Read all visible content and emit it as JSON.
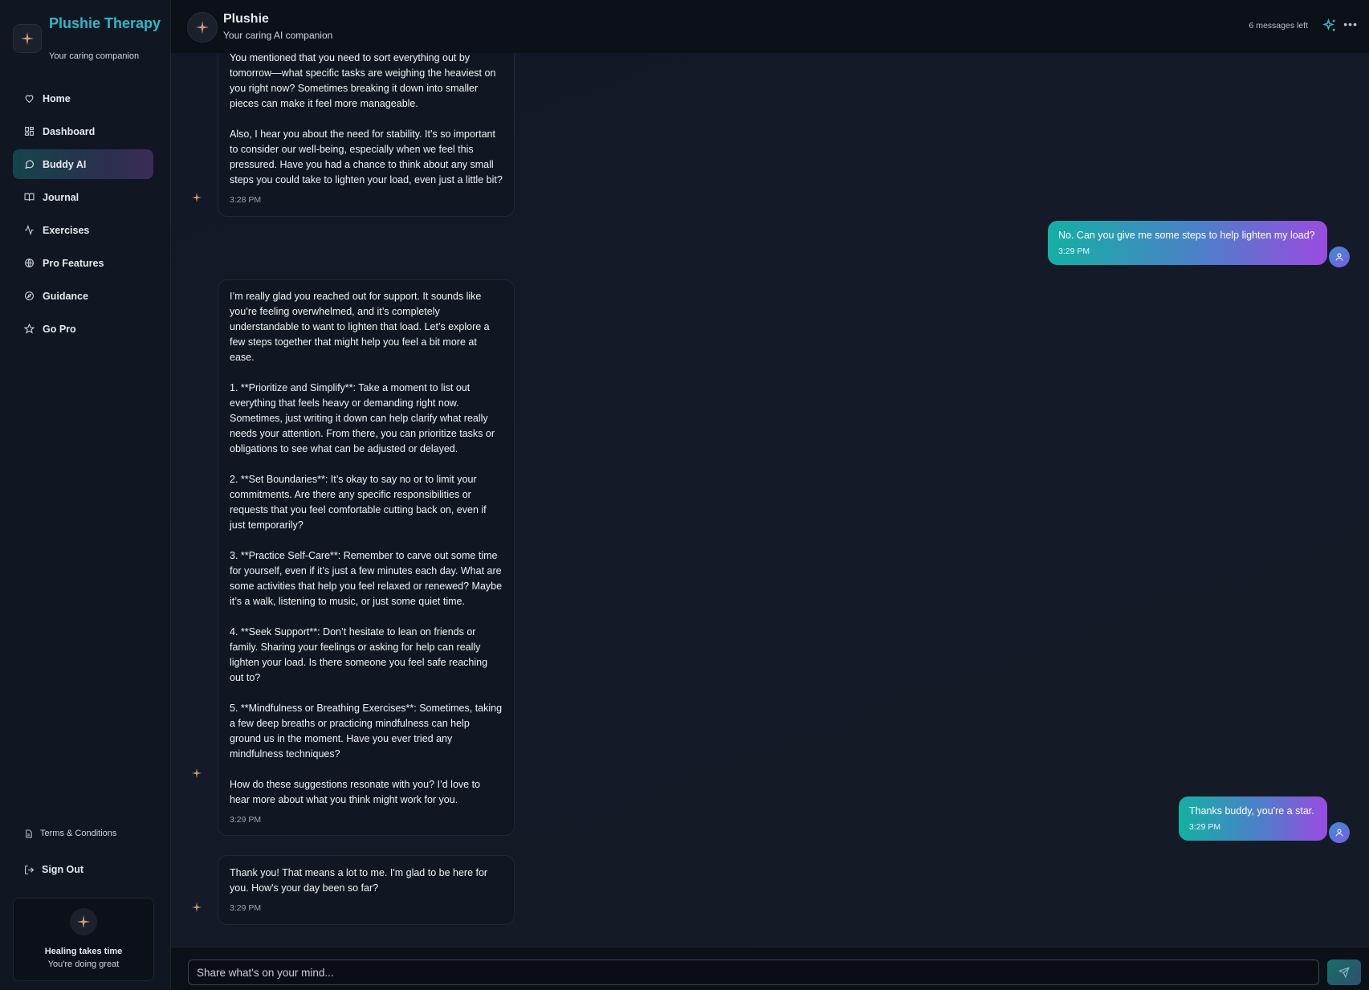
{
  "brand": {
    "title": "Plushie Therapy",
    "subtitle": "Your caring companion"
  },
  "nav": [
    {
      "label": "Home",
      "icon": "heart-icon"
    },
    {
      "label": "Dashboard",
      "icon": "grid-icon"
    },
    {
      "label": "Buddy AI",
      "icon": "chat-icon",
      "active": true
    },
    {
      "label": "Journal",
      "icon": "book-icon"
    },
    {
      "label": "Exercises",
      "icon": "activity-icon"
    },
    {
      "label": "Pro Features",
      "icon": "globe-icon"
    },
    {
      "label": "Guidance",
      "icon": "compass-icon"
    },
    {
      "label": "Go Pro",
      "icon": "star-icon"
    }
  ],
  "footer": {
    "terms": "Terms & Conditions",
    "signout": "Sign Out",
    "card_title": "Healing takes time",
    "card_subtitle": "You're doing great"
  },
  "header": {
    "title": "Plushie",
    "subtitle": "Your caring AI companion",
    "messages_left": "6 messages left"
  },
  "messages": [
    {
      "role": "ai",
      "paragraphs": [
        "You mentioned that you need to sort everything out by tomorrow—what specific tasks are weighing the heaviest on you right now? Sometimes breaking it down into smaller pieces can make it feel more manageable.",
        "Also, I hear you about the need for stability. It’s so important to consider our well-being, especially when we feel this pressured. Have you had a chance to think about any small steps you could take to lighten your load, even just a little bit?"
      ],
      "time": "3:28 PM"
    },
    {
      "role": "user",
      "text": "No. Can you give me some steps to help lighten my load?",
      "time": "3:29 PM"
    },
    {
      "role": "ai",
      "paragraphs": [
        "I’m really glad you reached out for support. It sounds like you’re feeling overwhelmed, and it’s completely understandable to want to lighten that load. Let’s explore a few steps together that might help you feel a bit more at ease.",
        "1. **Prioritize and Simplify**: Take a moment to list out everything that feels heavy or demanding right now. Sometimes, just writing it down can help clarify what really needs your attention. From there, you can prioritize tasks or obligations to see what can be adjusted or delayed.",
        "2. **Set Boundaries**: It’s okay to say no or to limit your commitments. Are there any specific responsibilities or requests that you feel comfortable cutting back on, even if just temporarily?",
        "3. **Practice Self-Care**: Remember to carve out some time for yourself, even if it’s just a few minutes each day. What are some activities that help you feel relaxed or renewed? Maybe it’s a walk, listening to music, or just some quiet time.",
        "4. **Seek Support**: Don’t hesitate to lean on friends or family. Sharing your feelings or asking for help can really lighten your load. Is there someone you feel safe reaching out to?",
        "5. **Mindfulness or Breathing Exercises**: Sometimes, taking a few deep breaths or practicing mindfulness can help ground us in the moment. Have you ever tried any mindfulness techniques?",
        "How do these suggestions resonate with you? I’d love to hear more about what you think might work for you."
      ],
      "time": "3:29 PM"
    },
    {
      "role": "user",
      "text": "Thanks buddy, you're a star.",
      "time": "3:29 PM"
    },
    {
      "role": "ai",
      "paragraphs": [
        "Thank you! That means a lot to me. I'm glad to be here for you. How's your day been so far?"
      ],
      "time": "3:29 PM"
    }
  ],
  "input": {
    "placeholder": "Share what's on your mind..."
  },
  "colors": {
    "accent": "#2fb8c7",
    "user_gradient_start": "#14b0a4",
    "user_gradient_end": "#9a4be0",
    "ai_mark": "#c9a07a"
  }
}
